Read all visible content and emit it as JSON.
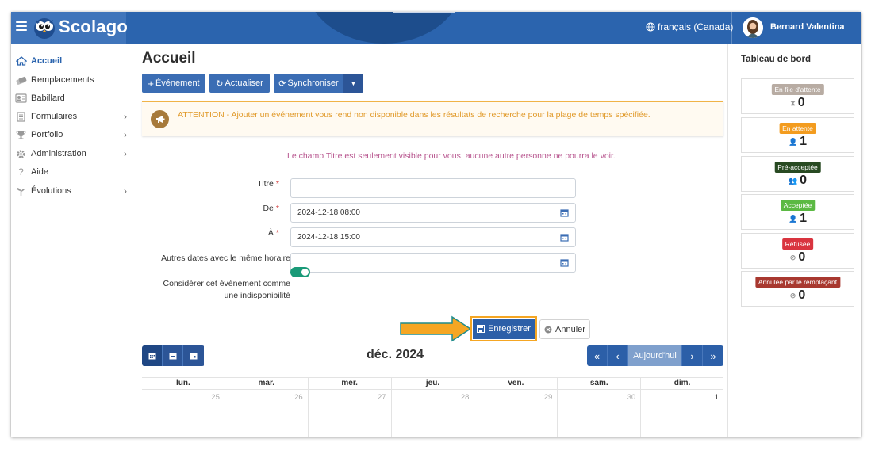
{
  "header": {
    "brand": "Scolago",
    "language": "français (Canada)",
    "user_name": "Bernard Valentina"
  },
  "sidebar": {
    "items": [
      {
        "label": "Accueil",
        "icon": "home-icon",
        "active": true,
        "has_children": false
      },
      {
        "label": "Remplacements",
        "icon": "substitutes-icon",
        "active": false,
        "has_children": false
      },
      {
        "label": "Babillard",
        "icon": "bulletin-board-icon",
        "active": false,
        "has_children": false
      },
      {
        "label": "Formulaires",
        "icon": "form-icon",
        "active": false,
        "has_children": true
      },
      {
        "label": "Portfolio",
        "icon": "trophy-icon",
        "active": false,
        "has_children": true
      },
      {
        "label": "Administration",
        "icon": "gear-icon",
        "active": false,
        "has_children": true
      },
      {
        "label": "Aide",
        "icon": "help-icon",
        "active": false,
        "has_children": false
      },
      {
        "label": "Évolutions",
        "icon": "sprout-icon",
        "active": false,
        "has_children": true
      }
    ]
  },
  "main": {
    "title": "Accueil",
    "toolbar": {
      "event_label": "Événement",
      "refresh_label": "Actualiser",
      "sync_label": "Synchroniser"
    },
    "alert": "ATTENTION - Ajouter un événement vous rend non disponible dans les résultats de recherche pour la plage de temps spécifiée.",
    "note": "Le champ Titre est seulement visible pour vous, aucune autre personne ne pourra le voir.",
    "form": {
      "title_label": "Titre",
      "title_value": "",
      "from_label": "De",
      "from_value": "2024-12-18 08:00",
      "to_label": "À",
      "to_value": "2024-12-18 15:00",
      "other_dates_label": "Autres dates avec le même horaire",
      "other_dates_value": "",
      "unavailable_label_line1": "Considérer cet événement comme",
      "unavailable_label_line2": "une indisponibilité",
      "unavailable_checked": true,
      "save_label": "Enregistrer",
      "cancel_label": "Annuler"
    },
    "calendar": {
      "month": "déc. 2024",
      "today_label": "Aujourd'hui",
      "days": [
        "lun.",
        "mar.",
        "mer.",
        "jeu.",
        "ven.",
        "sam.",
        "dim."
      ],
      "first_row": [
        "25",
        "26",
        "27",
        "28",
        "29",
        "30",
        "1"
      ]
    }
  },
  "dashboard": {
    "title": "Tableau de bord",
    "cards": [
      {
        "label": "En file d'attente",
        "count": "0",
        "color": "#b8aca3",
        "icon": "hourglass-icon"
      },
      {
        "label": "En attente",
        "count": "1",
        "color": "#f39c1f",
        "icon": "user-clock-icon"
      },
      {
        "label": "Pré-acceptée",
        "count": "0",
        "color": "#284a22",
        "icon": "users-icon"
      },
      {
        "label": "Acceptée",
        "count": "1",
        "color": "#5bb943",
        "icon": "user-check-icon"
      },
      {
        "label": "Refusée",
        "count": "0",
        "color": "#d9343f",
        "icon": "user-slash-icon"
      },
      {
        "label": "Annulée par le remplaçant",
        "count": "0",
        "color": "#a8382f",
        "icon": "user-slash-icon"
      }
    ]
  },
  "colors": {
    "primary": "#2b64ae",
    "accent_orange": "#f5a623",
    "toggle_on": "#1a9a78"
  }
}
